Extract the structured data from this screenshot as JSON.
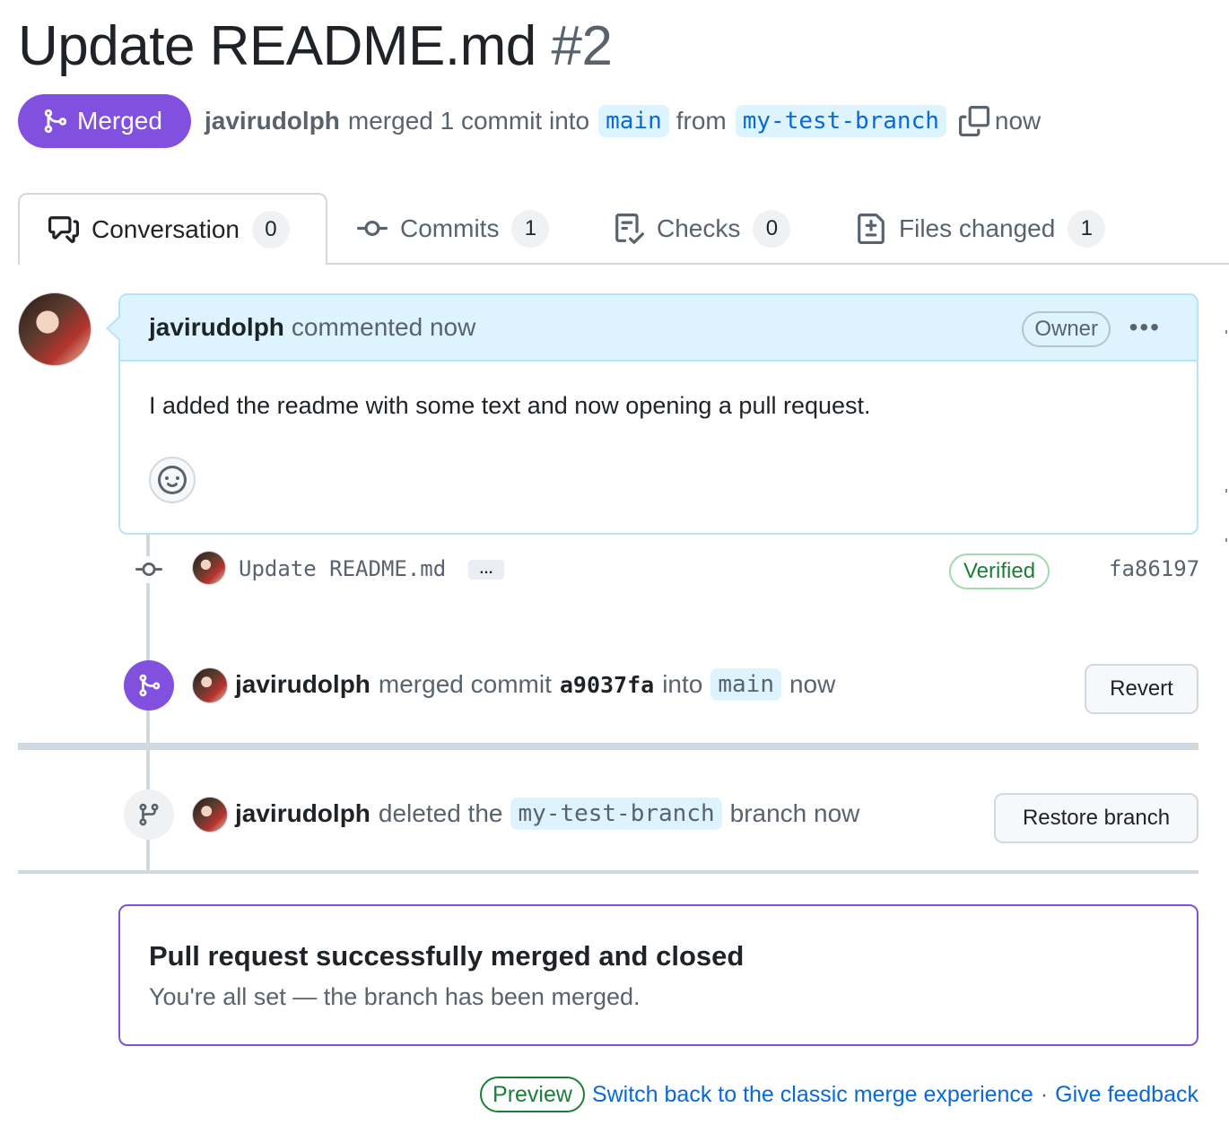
{
  "pr": {
    "title": "Update README.md",
    "number": "#2",
    "status": "Merged",
    "author": "javirudolph",
    "merge_text": "merged 1 commit into",
    "base_branch": "main",
    "from_text": "from",
    "head_branch": "my-test-branch",
    "time": "now"
  },
  "tabs": [
    {
      "label": "Conversation",
      "count": "0"
    },
    {
      "label": "Commits",
      "count": "1"
    },
    {
      "label": "Checks",
      "count": "0"
    },
    {
      "label": "Files changed",
      "count": "1"
    }
  ],
  "comment": {
    "author": "javirudolph",
    "action": "commented now",
    "role": "Owner",
    "menu": "•••",
    "body": "I added the readme with some text and now opening a pull request."
  },
  "commit_event": {
    "message": "Update README.md",
    "ellipsis": "…",
    "verified": "Verified",
    "sha": "fa86197"
  },
  "merge_event": {
    "author": "javirudolph",
    "text": "merged commit",
    "commit": "a9037fa",
    "into": "into",
    "branch": "main",
    "time": "now",
    "button": "Revert"
  },
  "delete_event": {
    "author": "javirudolph",
    "text": "deleted the",
    "branch": "my-test-branch",
    "suffix": "branch now",
    "button": "Restore branch"
  },
  "merge_box": {
    "title": "Pull request successfully merged and closed",
    "subtitle": "You're all set — the branch has been merged."
  },
  "footer": {
    "preview": "Preview",
    "switch_link": "Switch back to the classic merge experience",
    "separator": "·",
    "feedback_link": "Give feedback"
  },
  "colors": {
    "merged_purple": "#8250df",
    "link_blue": "#0969da",
    "branch_bg": "#ddf4ff",
    "verified_green": "#1a7f37"
  }
}
